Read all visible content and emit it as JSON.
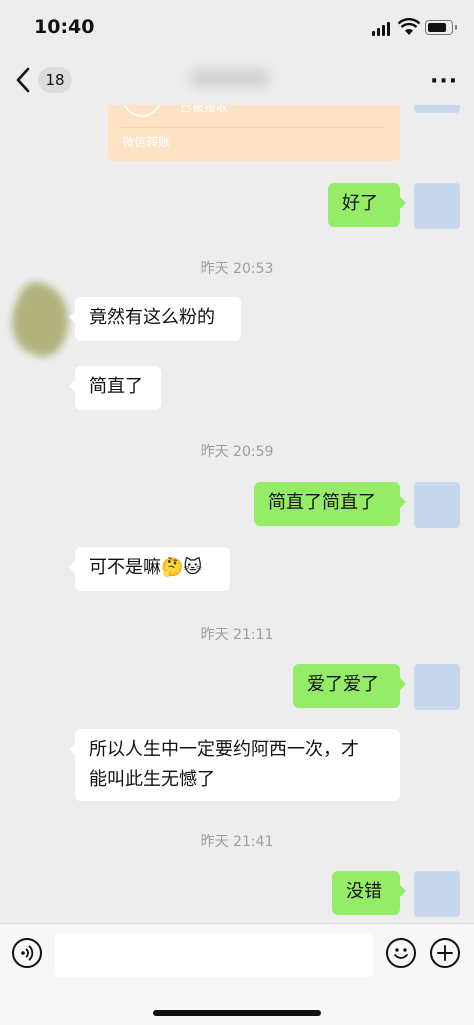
{
  "status_bar": {
    "time": "10:40",
    "battery_level": 0.85
  },
  "nav": {
    "unread_count": "18"
  },
  "transfer_card": {
    "status": "已被接收",
    "footer": "微信转账",
    "color": "#fde2c4"
  },
  "messages": [
    {
      "side": "right",
      "text": "好了"
    },
    {
      "side": "left",
      "text": "竟然有这么粉的"
    },
    {
      "side": "left",
      "text": "简直了"
    },
    {
      "side": "right",
      "text": "简直了简直了"
    },
    {
      "side": "left",
      "text": "可不是嘛🤔🐱"
    },
    {
      "side": "right",
      "text": "爱了爱了"
    },
    {
      "side": "left",
      "text": "所以人生中一定要约阿西一次，才\n能叫此生无憾了"
    },
    {
      "side": "right",
      "text": "没错"
    }
  ],
  "timestamps": [
    "昨天 20:53",
    "昨天 20:59",
    "昨天 21:11",
    "昨天 21:41"
  ],
  "colors": {
    "bubble_right": "#95ec69",
    "bubble_left": "#ffffff",
    "background": "#ededed"
  },
  "input_bar": {
    "voice_icon": "voice-icon",
    "emoji_icon": "emoji-icon",
    "plus_icon": "plus-icon"
  }
}
